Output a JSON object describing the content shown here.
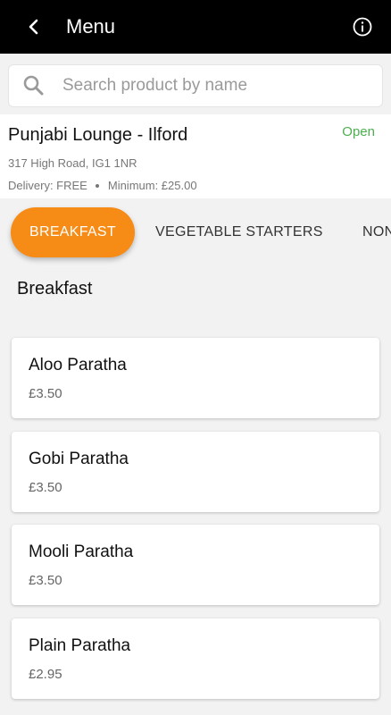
{
  "app_bar": {
    "title": "Menu"
  },
  "search": {
    "placeholder": "Search product by name",
    "value": ""
  },
  "store": {
    "name": "Punjabi Lounge - Ilford",
    "status": "Open",
    "address": "317 High Road, IG1 1NR",
    "delivery": "Delivery: FREE",
    "minimum": "Minimum: £25.00"
  },
  "tabs": [
    {
      "label": "BREAKFAST",
      "active": true
    },
    {
      "label": "VEGETABLE STARTERS",
      "active": false
    },
    {
      "label": "NON",
      "active": false
    }
  ],
  "section": {
    "title": "Breakfast"
  },
  "products": [
    {
      "name": "Aloo Paratha",
      "price": "£3.50"
    },
    {
      "name": "Gobi Paratha",
      "price": "£3.50"
    },
    {
      "name": "Mooli Paratha",
      "price": "£3.50"
    },
    {
      "name": "Plain Paratha",
      "price": "£2.95"
    }
  ],
  "colors": {
    "accent": "#f68b16",
    "open_status": "#4caf50",
    "app_bar": "#000000"
  },
  "icons": {
    "back": "chevron-left-icon",
    "info": "info-icon",
    "search": "search-icon"
  }
}
